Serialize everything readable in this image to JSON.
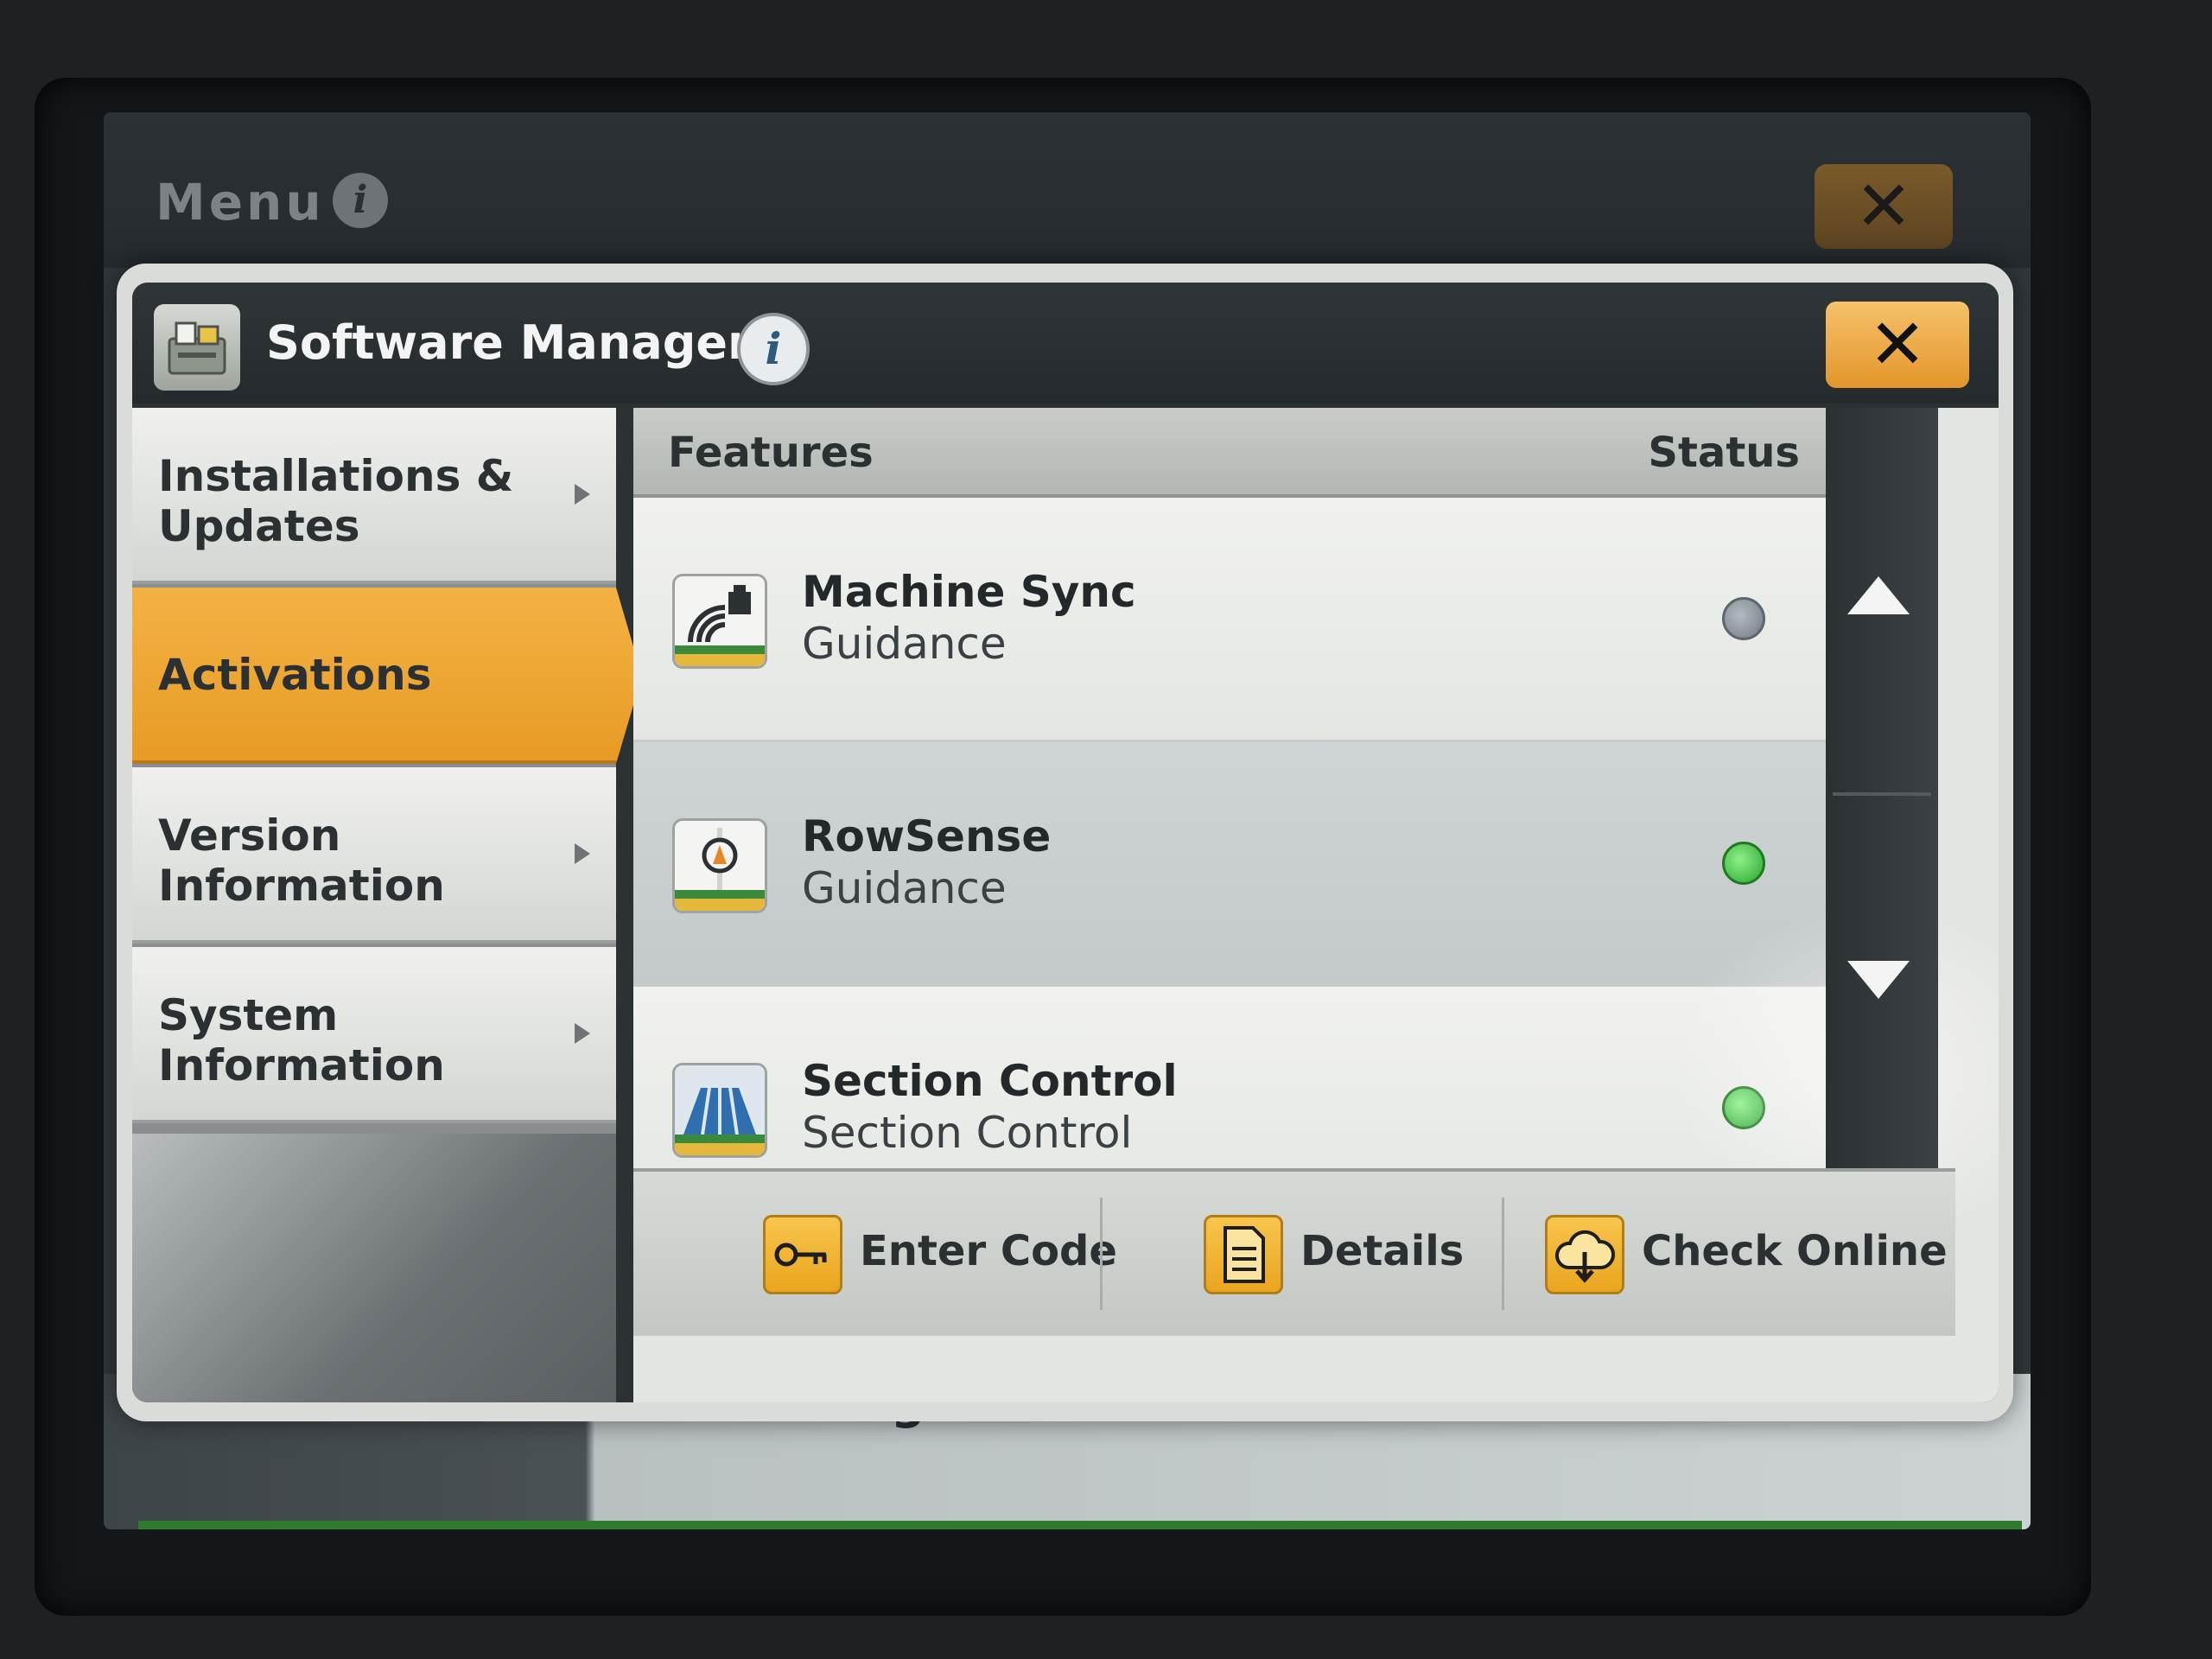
{
  "menu": {
    "title": "Menu",
    "info_icon": "info-icon",
    "close_icon": "close-icon"
  },
  "background": {
    "partial_text": "Settings"
  },
  "dialog": {
    "title": "Software Manager",
    "info_icon": "info-icon",
    "close_icon": "close-icon",
    "app_icon": "software-manager-icon"
  },
  "nav": {
    "items": [
      {
        "label": "Installations & Updates",
        "active": false
      },
      {
        "label": "Activations",
        "active": true
      },
      {
        "label": "Version Information",
        "active": false
      },
      {
        "label": "System Information",
        "active": false
      }
    ]
  },
  "list": {
    "col_features": "Features",
    "col_status": "Status",
    "rows": [
      {
        "name": "Machine Sync",
        "category": "Guidance",
        "status": "inactive",
        "icon": "machine-sync-icon"
      },
      {
        "name": "RowSense",
        "category": "Guidance",
        "status": "active",
        "icon": "rowsense-icon"
      },
      {
        "name": "Section Control",
        "category": "Section Control",
        "status": "active",
        "icon": "section-control-icon"
      }
    ]
  },
  "toolbar": {
    "enter_code": "Enter Code",
    "details": "Details",
    "check_online": "Check Online"
  },
  "colors": {
    "accent": "#E89B25",
    "status_active": "#2AA52E",
    "status_inactive": "#6F7A82"
  }
}
